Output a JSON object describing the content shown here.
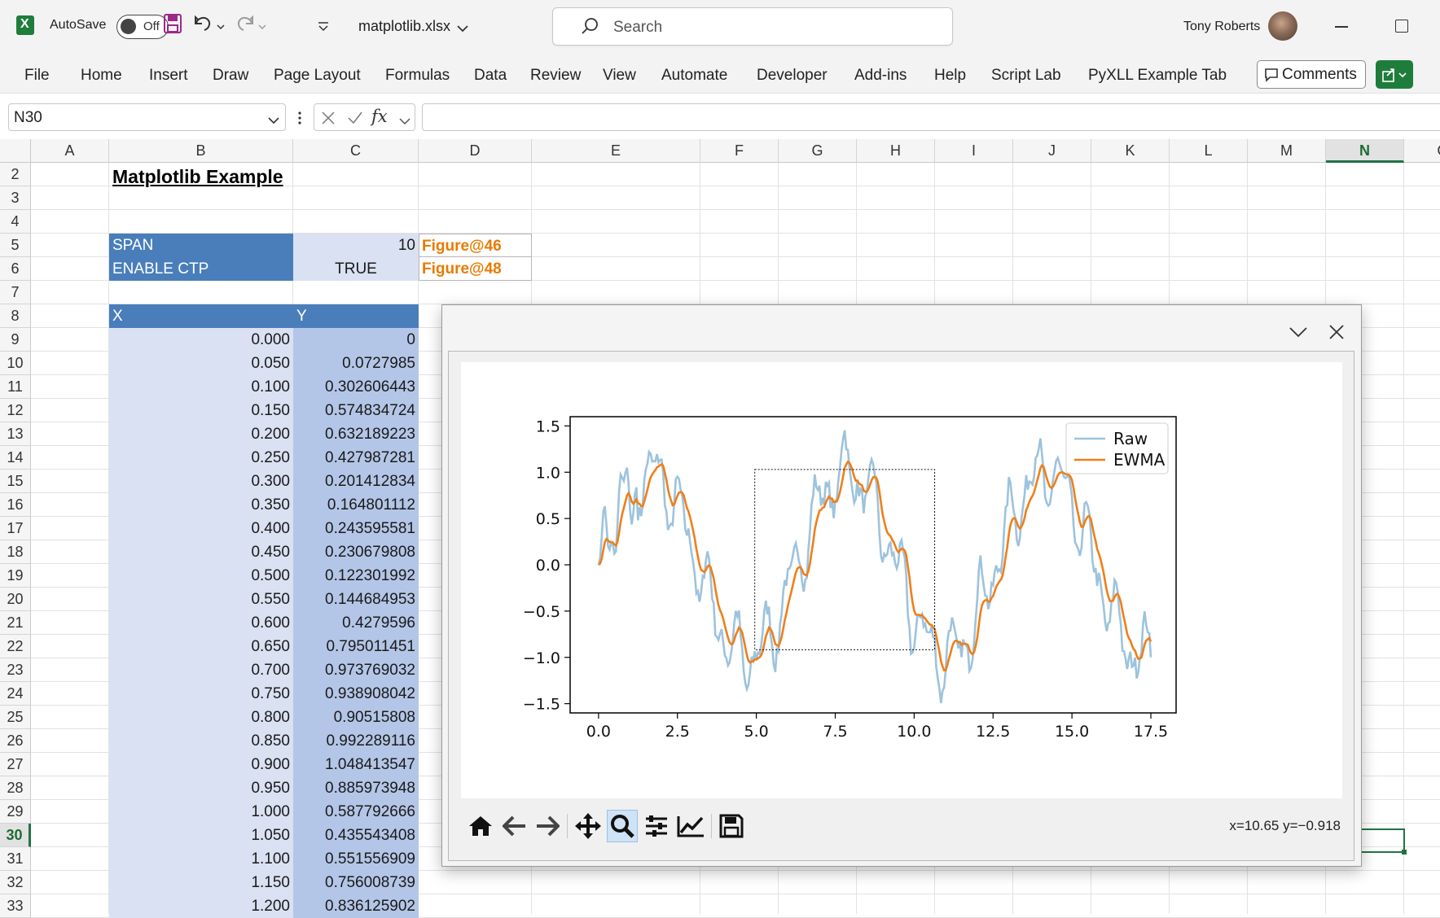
{
  "app": {
    "autosave_label": "AutoSave",
    "autosave_state": "Off",
    "file_name": "matplotlib.xlsx",
    "search_placeholder": "Search",
    "user_name": "Tony Roberts",
    "brand_color": "#1e7d3b"
  },
  "ribbon": {
    "tabs": [
      "File",
      "Home",
      "Insert",
      "Draw",
      "Page Layout",
      "Formulas",
      "Data",
      "Review",
      "View",
      "Automate",
      "Developer",
      "Add-ins",
      "Help",
      "Script Lab",
      "PyXLL Example Tab"
    ],
    "comments_label": "Comments"
  },
  "formula_bar": {
    "name_box": "N30",
    "fx_label": "fx",
    "formula": ""
  },
  "sheet": {
    "columns": [
      "A",
      "B",
      "C",
      "D",
      "E",
      "F",
      "G",
      "H",
      "I",
      "J",
      "K",
      "L",
      "M",
      "N",
      "O"
    ],
    "selected_column": "N",
    "selected_row": "30",
    "rows": [
      "2",
      "3",
      "4",
      "5",
      "6",
      "7",
      "8",
      "9",
      "10",
      "11",
      "12",
      "13",
      "14",
      "15",
      "16",
      "17",
      "18",
      "19",
      "20",
      "21",
      "22",
      "23",
      "24",
      "25",
      "26",
      "27",
      "28",
      "29",
      "30",
      "31",
      "32",
      "33"
    ],
    "title": "Matplotlib Example",
    "params": [
      {
        "label": "SPAN",
        "value": "10",
        "figure": "Figure@46"
      },
      {
        "label": "ENABLE CTP",
        "value": "TRUE",
        "figure": "Figure@48"
      }
    ],
    "table_header": {
      "x": "X",
      "y": "Y"
    },
    "table_rows": [
      [
        "0.000",
        "0"
      ],
      [
        "0.050",
        "0.0727985"
      ],
      [
        "0.100",
        "0.302606443"
      ],
      [
        "0.150",
        "0.574834724"
      ],
      [
        "0.200",
        "0.632189223"
      ],
      [
        "0.250",
        "0.427987281"
      ],
      [
        "0.300",
        "0.201412834"
      ],
      [
        "0.350",
        "0.164801112"
      ],
      [
        "0.400",
        "0.243595581"
      ],
      [
        "0.450",
        "0.230679808"
      ],
      [
        "0.500",
        "0.122301992"
      ],
      [
        "0.550",
        "0.144684953"
      ],
      [
        "0.600",
        "0.4279596"
      ],
      [
        "0.650",
        "0.795011451"
      ],
      [
        "0.700",
        "0.973769032"
      ],
      [
        "0.750",
        "0.938908042"
      ],
      [
        "0.800",
        "0.90515808"
      ],
      [
        "0.850",
        "0.992289116"
      ],
      [
        "0.900",
        "1.048413547"
      ],
      [
        "0.950",
        "0.885973948"
      ],
      [
        "1.000",
        "0.587792666"
      ],
      [
        "1.050",
        "0.435543408"
      ],
      [
        "1.100",
        "0.551556909"
      ],
      [
        "1.150",
        "0.756008739"
      ],
      [
        "1.200",
        "0.836125902"
      ]
    ]
  },
  "plot_pane": {
    "coords_readout": "x=10.65 y=−0.918",
    "toolbar": [
      "home-icon",
      "back-arrow-icon",
      "forward-arrow-icon",
      "pan-icon",
      "zoom-icon",
      "configure-subplots-icon",
      "edit-axis-icon",
      "save-icon"
    ],
    "active_tool": "zoom-icon",
    "zoom_rect": {
      "x0": 4.95,
      "x1": 10.65,
      "y0": -0.918,
      "y1": 1.03
    }
  },
  "chart_data": {
    "type": "line",
    "xlim": [
      -0.9,
      18.3
    ],
    "ylim": [
      -1.6,
      1.6
    ],
    "xticks": [
      "0.0",
      "2.5",
      "5.0",
      "7.5",
      "10.0",
      "12.5",
      "15.0",
      "17.5"
    ],
    "xtick_values": [
      0,
      2.5,
      5,
      7.5,
      10,
      12.5,
      15,
      17.5
    ],
    "yticks": [
      "1.5",
      "1.0",
      "0.5",
      "0.0",
      "−0.5",
      "−1.0",
      "−1.5"
    ],
    "ytick_values": [
      1.5,
      1.0,
      0.5,
      0,
      -0.5,
      -1.0,
      -1.5
    ],
    "legend_position": "top-right",
    "series": [
      {
        "name": "Raw",
        "color": "#9dc3dd",
        "x_start": 0,
        "x_step": 0.05,
        "count": 351
      },
      {
        "name": "EWMA",
        "color": "#ef7f1a",
        "span": 10
      }
    ],
    "raw_first_values": [
      0,
      0.0727985,
      0.302606443,
      0.574834724,
      0.632189223,
      0.427987281,
      0.201412834,
      0.164801112,
      0.243595581,
      0.230679808,
      0.122301992,
      0.144684953,
      0.4279596,
      0.795011451,
      0.973769032,
      0.938908042,
      0.90515808,
      0.992289116,
      1.048413547,
      0.885973948,
      0.587792666,
      0.435543408,
      0.551556909,
      0.756008739,
      0.836125902
    ]
  }
}
